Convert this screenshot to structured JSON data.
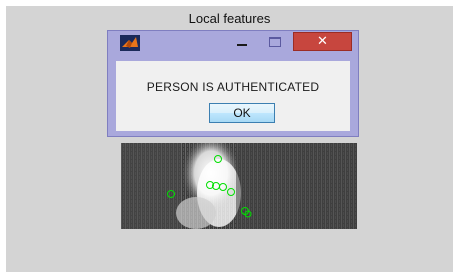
{
  "figure": {
    "title": "Local features"
  },
  "dialog": {
    "app_icon": "matlab-logo-icon",
    "minimize_glyph": "–",
    "close_glyph": "✕",
    "message": "PERSON IS AUTHENTICATED",
    "ok_label": "OK"
  },
  "colors": {
    "figure_bg": "#d4d4d4",
    "dialog_frame": "#a9a8dc",
    "close_button": "#c7463e",
    "feature_marker": "#00e000"
  }
}
